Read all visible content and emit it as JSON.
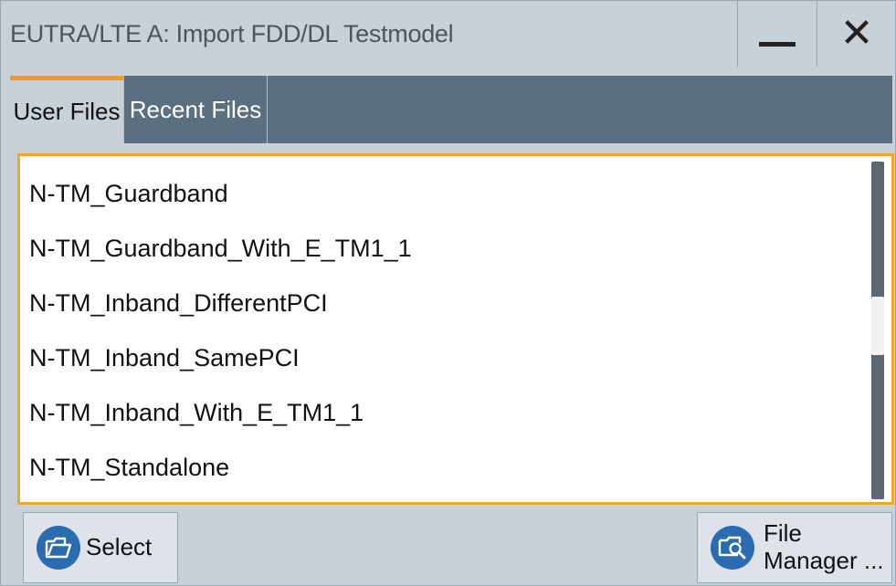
{
  "window": {
    "title": "EUTRA/LTE  A: Import FDD/DL Testmodel",
    "minimize_icon": "minimize-icon",
    "close_icon": "close-icon",
    "close_glyph": "✕"
  },
  "tabs": [
    {
      "label": "User Files",
      "active": true
    },
    {
      "label": "Recent Files",
      "active": false
    }
  ],
  "files": [
    "N-TM_Guardband",
    "N-TM_Guardband_With_E_TM1_1",
    "N-TM_Inband_DifferentPCI",
    "N-TM_Inband_SamePCI",
    "N-TM_Inband_With_E_TM1_1",
    "N-TM_Standalone"
  ],
  "buttons": {
    "select_label": "Select",
    "select_icon": "folder-icon",
    "file_manager_line1": "File",
    "file_manager_line2": "Manager ...",
    "file_manager_icon": "folder-search-icon"
  },
  "colors": {
    "accent": "#f39c12",
    "tab_bar": "#5a7080",
    "icon_blue": "#2b6cb0"
  }
}
